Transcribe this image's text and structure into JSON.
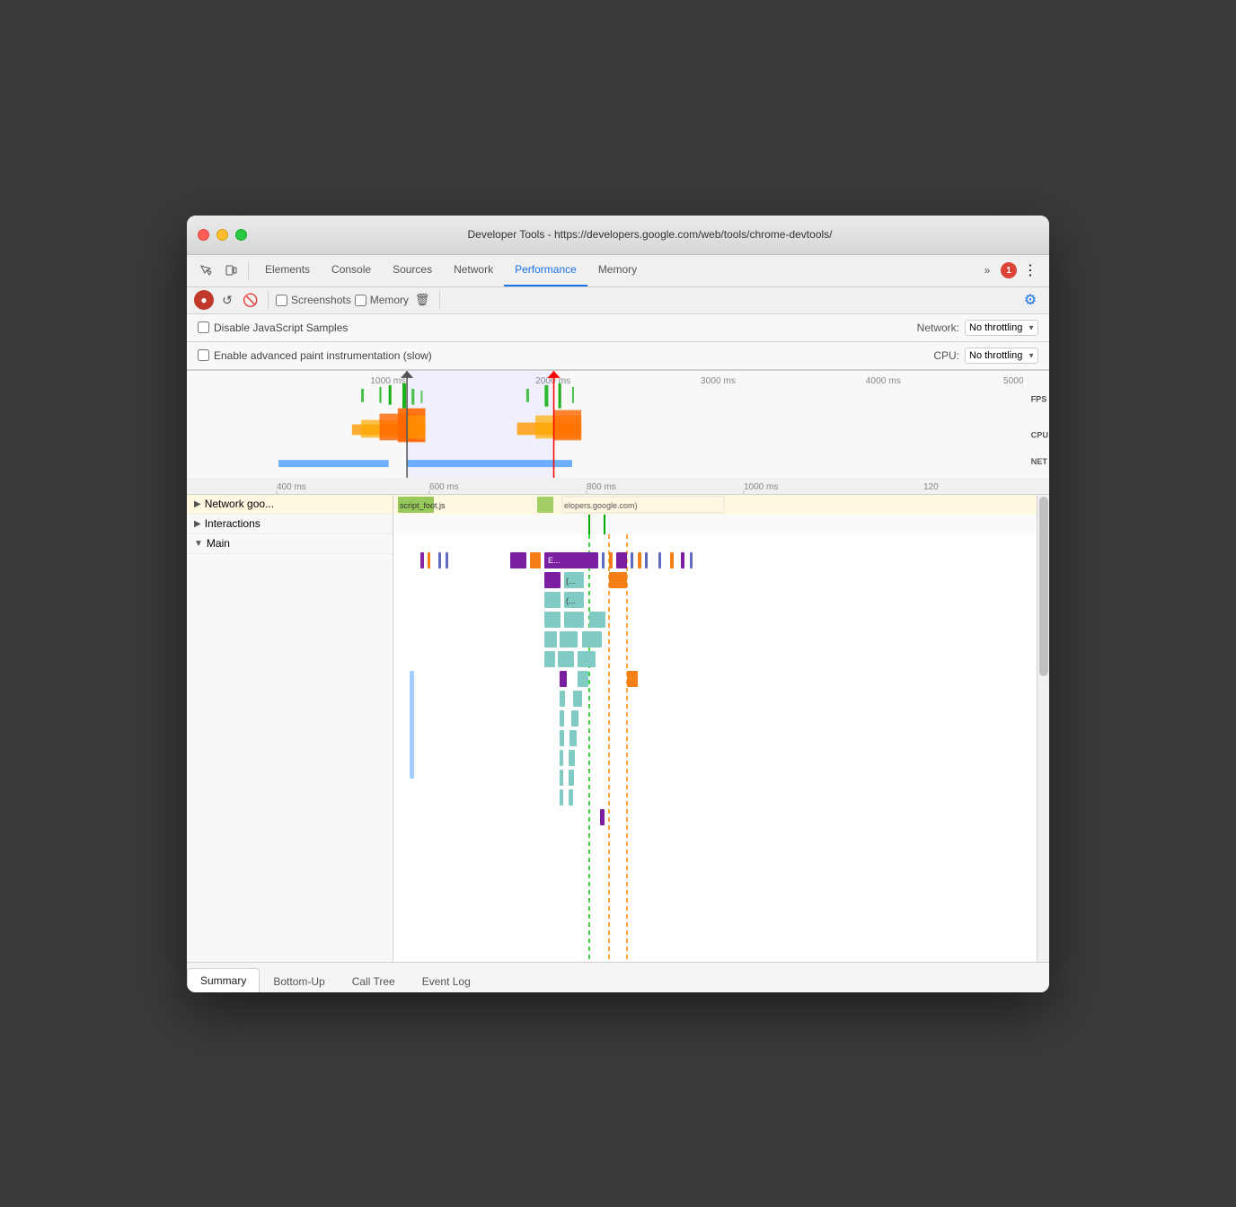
{
  "window": {
    "title": "Developer Tools - https://developers.google.com/web/tools/chrome-devtools/"
  },
  "tabs": {
    "items": [
      {
        "label": "Elements",
        "active": false
      },
      {
        "label": "Console",
        "active": false
      },
      {
        "label": "Sources",
        "active": false
      },
      {
        "label": "Network",
        "active": false
      },
      {
        "label": "Performance",
        "active": true
      },
      {
        "label": "Memory",
        "active": false
      }
    ],
    "overflow_label": "»",
    "error_count": "1",
    "more_label": "⋮"
  },
  "perf_toolbar": {
    "screenshots_label": "Screenshots",
    "memory_label": "Memory"
  },
  "settings": {
    "disable_js_samples": "Disable JavaScript Samples",
    "advanced_paint": "Enable advanced paint instrumentation (slow)",
    "network_label": "Network:",
    "network_value": "No throttling",
    "cpu_label": "CPU:",
    "cpu_value": "No throttling"
  },
  "overview": {
    "time_markers": [
      "1000 ms",
      "2000 ms",
      "3000 ms",
      "4000 ms"
    ],
    "labels": [
      "FPS",
      "CPU",
      "NET"
    ]
  },
  "detail_ruler": {
    "marks": [
      "400 ms",
      "600 ms",
      "800 ms",
      "1000 ms",
      "120"
    ]
  },
  "flame_tracks": [
    {
      "label": "Network goo...",
      "expanded": false,
      "indent": 0
    },
    {
      "label": "Interactions",
      "expanded": false,
      "indent": 0
    },
    {
      "label": "Main",
      "expanded": true,
      "indent": 0
    }
  ],
  "bottom_tabs": {
    "items": [
      {
        "label": "Summary",
        "active": true
      },
      {
        "label": "Bottom-Up",
        "active": false
      },
      {
        "label": "Call Tree",
        "active": false
      },
      {
        "label": "Event Log",
        "active": false
      }
    ]
  },
  "colors": {
    "active_tab": "#1a73e8",
    "record_btn": "#c0392b",
    "settings_icon": "#1a73e8"
  }
}
